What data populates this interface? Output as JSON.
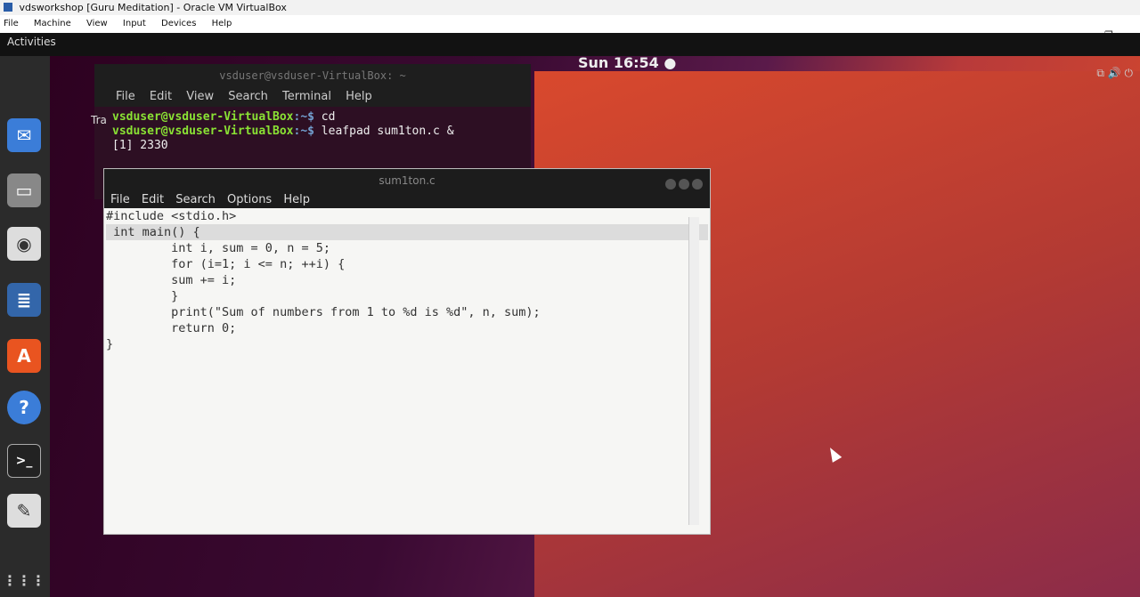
{
  "host": {
    "title": "vdsworkshop [Guru Meditation] - Oracle VM VirtualBox",
    "menu": [
      "File",
      "Machine",
      "View",
      "Input",
      "Devices",
      "Help"
    ]
  },
  "guest": {
    "activities": "Activities",
    "clock": "Sun 16:54 ●"
  },
  "terminal": {
    "title": "vsduser@vsduser-VirtualBox: ~",
    "menu": [
      "File",
      "Edit",
      "View",
      "Search",
      "Terminal",
      "Help"
    ],
    "prompt_user": "vsduser@vsduser-VirtualBox",
    "prompt_path": ":~$",
    "lines": [
      {
        "cmd": " cd"
      },
      {
        "cmd": " leafpad sum1ton.c &"
      }
    ],
    "output": "[1] 2330",
    "trash_label": "Tra"
  },
  "editor": {
    "title": "sum1ton.c",
    "menu": [
      "File",
      "Edit",
      "Search",
      "Options",
      "Help"
    ],
    "code": [
      "#include <stdio.h>",
      " int main() {",
      "         int i, sum = 0, n = 5;",
      "         for (i=1; i <= n; ++i) {",
      "         sum += i;",
      "         }",
      "         print(\"Sum of numbers from 1 to %d is %d\", n, sum);",
      "         return 0;",
      "}"
    ]
  }
}
